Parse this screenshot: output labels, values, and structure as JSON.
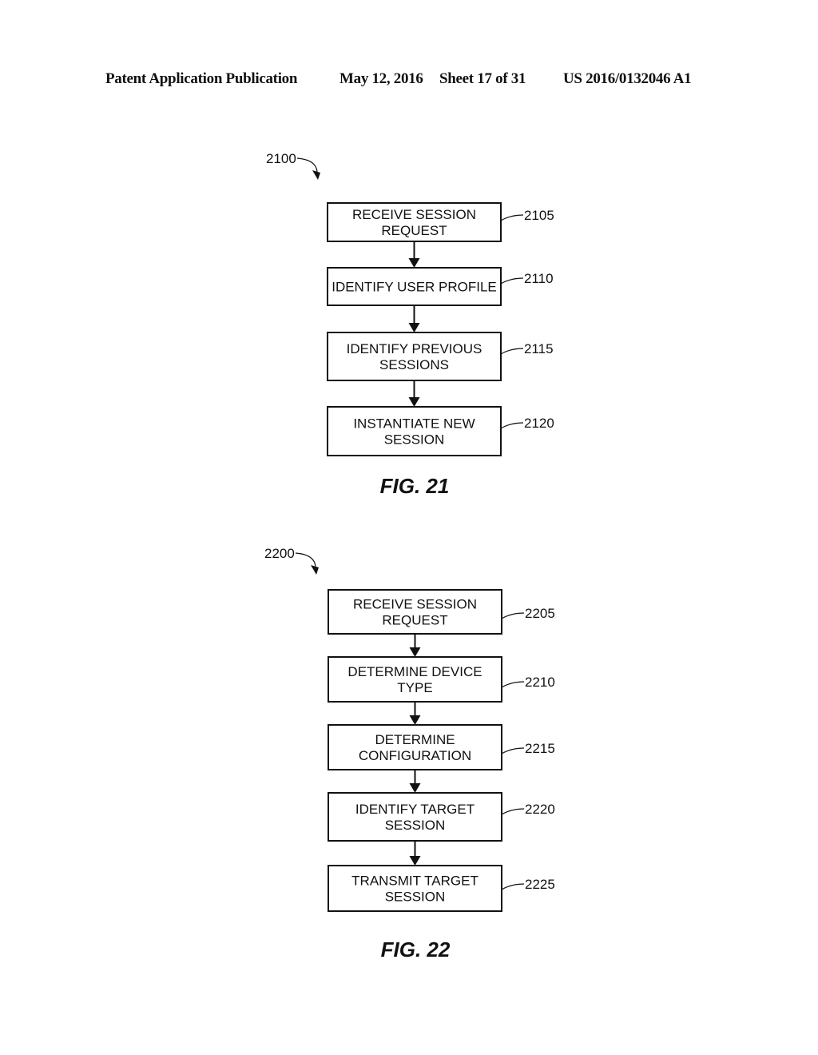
{
  "header": {
    "publication_type": "Patent Application Publication",
    "date": "May 12, 2016",
    "sheet": "Sheet 17 of 31",
    "patent_number": "US 2016/0132046 A1"
  },
  "figures": [
    {
      "id": "fig21",
      "label": "FIG. 21",
      "reference": "2100",
      "steps": [
        {
          "ref": "2105",
          "lines": [
            "RECEIVE SESSION",
            "REQUEST"
          ]
        },
        {
          "ref": "2110",
          "lines": [
            "IDENTIFY USER PROFILE"
          ]
        },
        {
          "ref": "2115",
          "lines": [
            "IDENTIFY PREVIOUS",
            "SESSIONS"
          ]
        },
        {
          "ref": "2120",
          "lines": [
            "INSTANTIATE NEW",
            "SESSION"
          ]
        }
      ]
    },
    {
      "id": "fig22",
      "label": "FIG. 22",
      "reference": "2200",
      "steps": [
        {
          "ref": "2205",
          "lines": [
            "RECEIVE SESSION",
            "REQUEST"
          ]
        },
        {
          "ref": "2210",
          "lines": [
            "DETERMINE DEVICE",
            "TYPE"
          ]
        },
        {
          "ref": "2215",
          "lines": [
            "DETERMINE",
            "CONFIGURATION"
          ]
        },
        {
          "ref": "2220",
          "lines": [
            "IDENTIFY TARGET",
            "SESSION"
          ]
        },
        {
          "ref": "2225",
          "lines": [
            "TRANSMIT TARGET",
            "SESSION"
          ]
        }
      ]
    }
  ]
}
